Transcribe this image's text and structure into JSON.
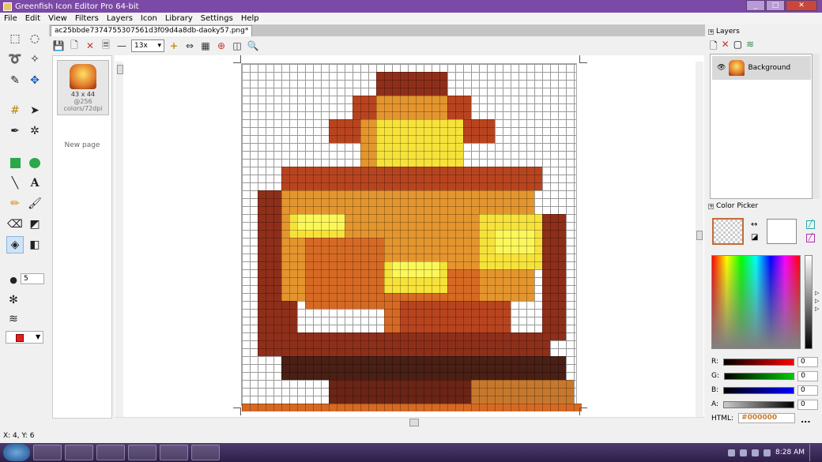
{
  "window": {
    "title": "Greenfish Icon Editor Pro 64-bit",
    "min": "_",
    "max": "□",
    "close": "✕"
  },
  "menu": [
    "File",
    "Edit",
    "View",
    "Filters",
    "Layers",
    "Icon",
    "Library",
    "Settings",
    "Help"
  ],
  "tab": {
    "label": "ac25bbde7374755307561d3f09d4a8db-daoky57.png*"
  },
  "toolbar": {
    "zoom": "13x"
  },
  "pages": {
    "thumb_size": "43 x 44",
    "thumb_info": "@256 colors/72dpi",
    "new_page": "New page"
  },
  "tools": {
    "brush_size": "5"
  },
  "layers": {
    "header": "Layers",
    "items": [
      {
        "name": "Background"
      }
    ]
  },
  "color_picker": {
    "header": "Color Picker",
    "r_label": "R:",
    "g_label": "G:",
    "b_label": "B:",
    "a_label": "A:",
    "r": "0",
    "g": "0",
    "b": "0",
    "a": "0",
    "html_label": "HTML:",
    "html_value": "#000000",
    "more": "..."
  },
  "status": {
    "coords": "X: 4, Y: 6"
  },
  "taskbar": {
    "time": "8:28 AM"
  },
  "colors": {
    "accent": "#7b4aa6",
    "primary_color": "#e02020"
  }
}
